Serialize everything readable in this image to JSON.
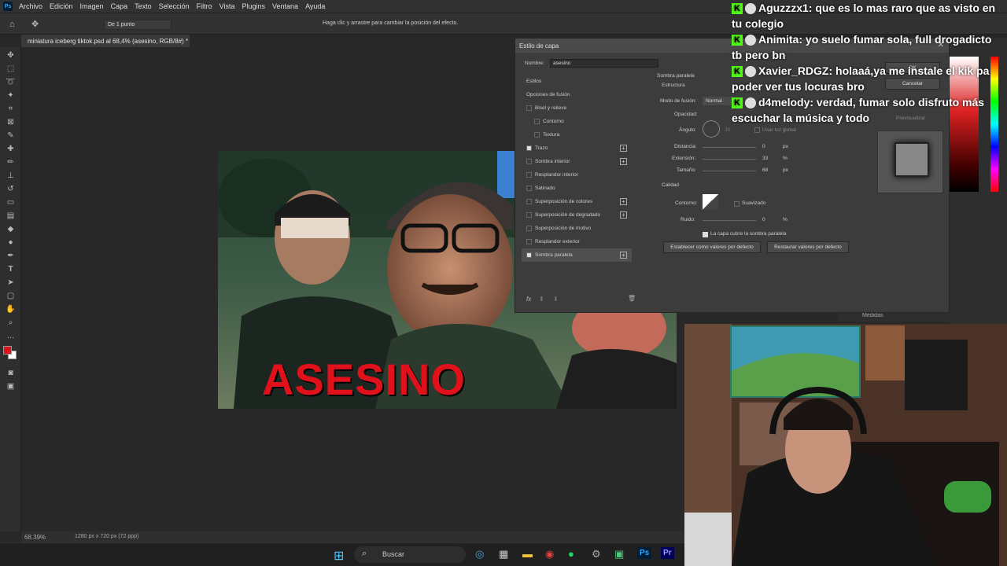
{
  "menu": {
    "logo": "Ps",
    "items": [
      "Archivo",
      "Edición",
      "Imagen",
      "Capa",
      "Texto",
      "Selección",
      "Filtro",
      "Vista",
      "Plugins",
      "Ventana",
      "Ayuda"
    ]
  },
  "options": {
    "sample_size": "De 1 punto",
    "hint": "Haga clic y arrastre para cambiar la posición del efecto."
  },
  "document": {
    "tab": "miniatura iceberg tiktok.psd al 68,4% (asesino, RGB/8#) *",
    "zoom": "68.39%",
    "size_info": "1280 px x 720 px (72 ppp)"
  },
  "thumbnail": {
    "headline": "ASESINO"
  },
  "dialog": {
    "title": "Estilo de capa",
    "name_label": "Nombre:",
    "name_value": "asesino",
    "styles_header": "Estilos",
    "items": [
      {
        "label": "Opciones de fusión",
        "checkbox": false,
        "checked": false,
        "plus": false,
        "indent": false
      },
      {
        "label": "Bisel y relieve",
        "checkbox": true,
        "checked": false,
        "plus": false,
        "indent": false
      },
      {
        "label": "Contorno",
        "checkbox": true,
        "checked": false,
        "plus": false,
        "indent": true
      },
      {
        "label": "Textura",
        "checkbox": true,
        "checked": false,
        "plus": false,
        "indent": true
      },
      {
        "label": "Trazo",
        "checkbox": true,
        "checked": true,
        "plus": true,
        "indent": false
      },
      {
        "label": "Sombra interior",
        "checkbox": true,
        "checked": false,
        "plus": true,
        "indent": false
      },
      {
        "label": "Resplandor interior",
        "checkbox": true,
        "checked": false,
        "plus": false,
        "indent": false
      },
      {
        "label": "Satinado",
        "checkbox": true,
        "checked": false,
        "plus": false,
        "indent": false
      },
      {
        "label": "Superposición de colores",
        "checkbox": true,
        "checked": false,
        "plus": true,
        "indent": false
      },
      {
        "label": "Superposición de degradado",
        "checkbox": true,
        "checked": false,
        "plus": true,
        "indent": false
      },
      {
        "label": "Superposición de motivo",
        "checkbox": true,
        "checked": false,
        "plus": false,
        "indent": false
      },
      {
        "label": "Resplandor exterior",
        "checkbox": true,
        "checked": false,
        "plus": false,
        "indent": false
      },
      {
        "label": "Sombra paralela",
        "checkbox": true,
        "checked": true,
        "plus": true,
        "indent": false,
        "selected": true
      }
    ],
    "section": "Sombra paralela",
    "structure": "Estructura",
    "blend_label": "Modo de fusión:",
    "blend_value": "Normal",
    "opacity_label": "Opacidad:",
    "angle_label": "Ángulo:",
    "angle_value": "30",
    "global_light": "Usar luz global",
    "distance_label": "Distancia:",
    "distance_value": "0",
    "spread_label": "Extensión:",
    "spread_value": "33",
    "size_label": "Tamaño:",
    "size_value": "68",
    "unit_px": "px",
    "unit_pct": "%",
    "quality": "Calidad",
    "contour_label": "Contorno:",
    "antialias": "Suavizado",
    "noise_label": "Ruido:",
    "noise_value": "0",
    "knockout": "La capa cubre la sombra paralela",
    "default_btn": "Establecer como valores por defecto",
    "reset_btn": "Restaurar valores por defecto",
    "cancel": "Cancelar",
    "preview": "Previsualizar",
    "ok": "OK"
  },
  "chat": [
    {
      "user": "Aguzzzx1",
      "msg": "que es lo mas raro que as visto en tu colegio"
    },
    {
      "user": "Animita",
      "msg": "yo suelo fumar sola, full drogadicto tb pero bn"
    },
    {
      "user": "Xavier_RDGZ",
      "msg": "holaaá,ya me instale el kik pa poder ver tus locuras bro"
    },
    {
      "user": "d4melody",
      "msg": "verdad, fumar solo disfruto más escuchar la música y todo"
    }
  ],
  "panels": {
    "measures": "Medidas"
  },
  "taskbar": {
    "search": "Buscar"
  },
  "colors": {
    "accent": "#31a8ff",
    "kick": "#53fc18",
    "headline": "#e0111b"
  }
}
